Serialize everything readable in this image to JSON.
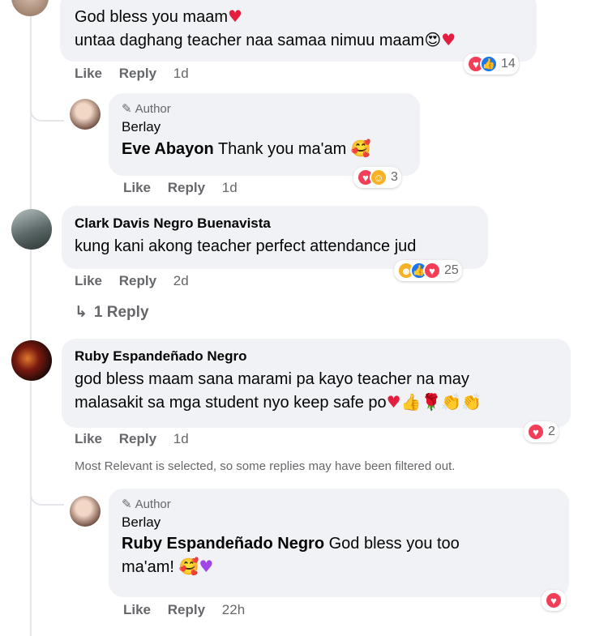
{
  "comments": {
    "c1": {
      "line1": "God bless you maam",
      "line2": "untaa daghang teacher naa samaa nimuu maam",
      "reaction_count": "14",
      "like": "Like",
      "reply": "Reply",
      "time": "1d"
    },
    "r1": {
      "author_tag": "Author",
      "name": "Berlay",
      "mention": "Eve Abayon",
      "text": "Thank you ma'am",
      "reaction_count": "3",
      "like": "Like",
      "reply": "Reply",
      "time": "1d"
    },
    "c2": {
      "name": "Clark Davis Negro Buenavista",
      "text": "kung kani akong teacher perfect attendance jud",
      "reaction_count": "25",
      "like": "Like",
      "reply": "Reply",
      "time": "2d",
      "replies_link": "1 Reply"
    },
    "c3": {
      "name": "Ruby Espandeñado Negro",
      "line1": "god bless maam sana marami pa kayo teacher na may",
      "line2": "malasakit sa mga student nyo keep safe po",
      "reaction_count": "2",
      "like": "Like",
      "reply": "Reply",
      "time": "1d"
    },
    "notice": "Most Relevant is selected, so some replies may have been filtered out.",
    "r2": {
      "author_tag": "Author",
      "name": "Berlay",
      "mention": "Ruby Espandeñado Negro",
      "text1": "God bless you too",
      "text2": "ma'am!",
      "like": "Like",
      "reply": "Reply",
      "time": "22h"
    }
  },
  "colors": {
    "love": "#f33e58",
    "like": "#1877f2",
    "haha": "#f7b125",
    "bubble": "#f0f2f5",
    "meta": "#65676b"
  }
}
